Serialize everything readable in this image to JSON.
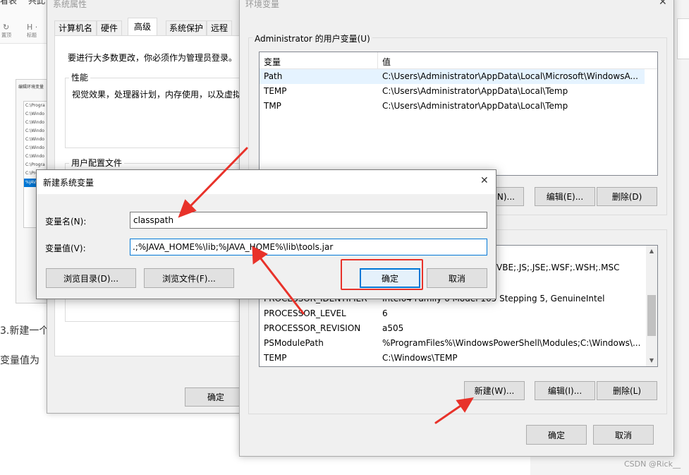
{
  "background_app": {
    "toolbar_fragments": [
      "看表",
      "共此"
    ],
    "small_labels": [
      "置顶",
      "标题"
    ],
    "thumb_title": "编辑环境变量",
    "thumb_rows": [
      "C:\\Progra",
      "C:\\Windo",
      "C:\\Windo",
      "C:\\Windo",
      "C:\\Windo",
      "C:\\Windo",
      "C:\\Windo",
      "C:\\Progra",
      "C:\\Progra",
      "%JAVA"
    ],
    "step_text": "3.新建一个",
    "value_text": "变量值为",
    "watermark": "CSDN @Rick__"
  },
  "sysprops": {
    "title": "系统属性",
    "tabs": [
      "计算机名",
      "硬件",
      "高级",
      "系统保护",
      "远程"
    ],
    "active_tab": "高级",
    "admin_note": "要进行大多数更改，你必须作为管理员登录。",
    "perf_group": "性能",
    "perf_desc": "视觉效果，处理器计划，内存使用，以及虚拟",
    "profile_group": "用户配置文件",
    "ok_label": "确定"
  },
  "envvars": {
    "title": "环境变量",
    "close_glyph": "✕",
    "user_group": "Administrator 的用户变量(U)",
    "columns": [
      "变量",
      "值"
    ],
    "user_vars": [
      {
        "name": "Path",
        "value": "C:\\Users\\Administrator\\AppData\\Local\\Microsoft\\WindowsA..."
      },
      {
        "name": "TEMP",
        "value": "C:\\Users\\Administrator\\AppData\\Local\\Temp"
      },
      {
        "name": "TMP",
        "value": "C:\\Users\\Administrator\\AppData\\Local\\Temp"
      }
    ],
    "user_new_label": "N)...",
    "user_edit_label": "编辑(E)...",
    "user_delete_label": "删除(D)",
    "sys_partial_row": "VBE;.JS;.JSE;.WSF;.WSH;.MSC",
    "sys_vars": [
      {
        "name": "PROCESSOR_IDENTIFIER",
        "value": "Intel64 Family 6 Model 165 Stepping 5, GenuineIntel"
      },
      {
        "name": "PROCESSOR_LEVEL",
        "value": "6"
      },
      {
        "name": "PROCESSOR_REVISION",
        "value": "a505"
      },
      {
        "name": "PSModulePath",
        "value": "%ProgramFiles%\\WindowsPowerShell\\Modules;C:\\Windows\\..."
      },
      {
        "name": "TEMP",
        "value": "C:\\Windows\\TEMP"
      }
    ],
    "sys_new_label": "新建(W)...",
    "sys_edit_label": "编辑(I)...",
    "sys_delete_label": "删除(L)",
    "ok_label": "确定",
    "cancel_label": "取消"
  },
  "newvar": {
    "title": "新建系统变量",
    "close_glyph": "✕",
    "name_label": "变量名(N):",
    "name_value": "classpath",
    "value_label": "变量值(V):",
    "value_value": ".;%JAVA_HOME%\\lib;%JAVA_HOME%\\lib\\tools.jar",
    "browse_dir_label": "浏览目录(D)...",
    "browse_file_label": "浏览文件(F)...",
    "ok_label": "确定",
    "cancel_label": "取消"
  },
  "colors": {
    "annotation_red": "#e8322a",
    "dialog_bg": "#f0f0f0",
    "focus_blue": "#0078d7",
    "selected_row": "#e5f3ff"
  }
}
